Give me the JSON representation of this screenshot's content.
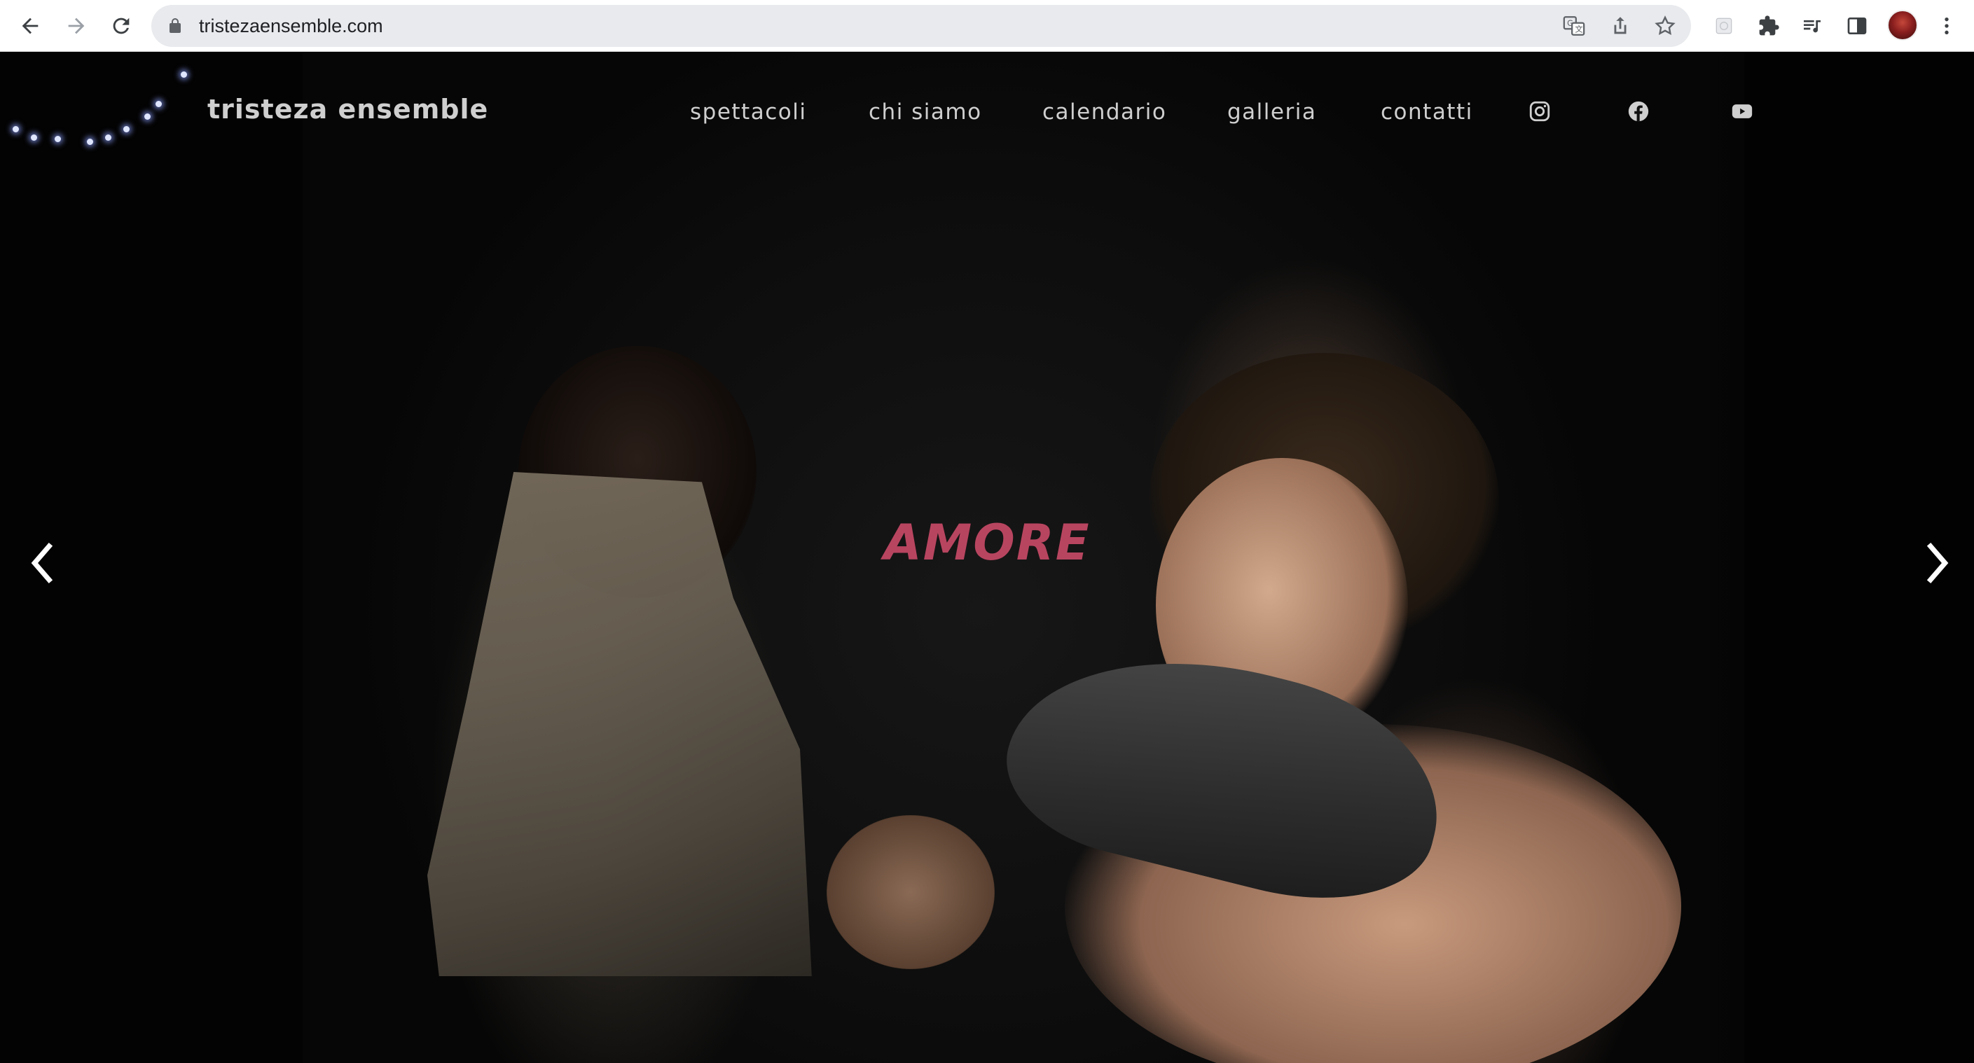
{
  "browser": {
    "url": "tristezaensemble.com",
    "icons": [
      "back-icon",
      "forward-icon",
      "reload-icon",
      "lock-icon",
      "translate-icon",
      "share-icon",
      "star-icon",
      "extension-icon",
      "puzzle-icon",
      "media-icon",
      "side-panel-icon",
      "avatar",
      "kebab-menu-icon"
    ]
  },
  "site": {
    "brand": "tristeza ensemble",
    "nav": [
      {
        "label": "spettacoli"
      },
      {
        "label": "chi siamo"
      },
      {
        "label": "calendario"
      },
      {
        "label": "galleria"
      },
      {
        "label": "contatti"
      }
    ],
    "social_icons": [
      "instagram-icon",
      "facebook-icon",
      "youtube-icon"
    ]
  },
  "slider": {
    "title": "AMORE",
    "title_color": "#b84560",
    "prev_icon": "chevron-left-icon",
    "next_icon": "chevron-right-icon"
  }
}
